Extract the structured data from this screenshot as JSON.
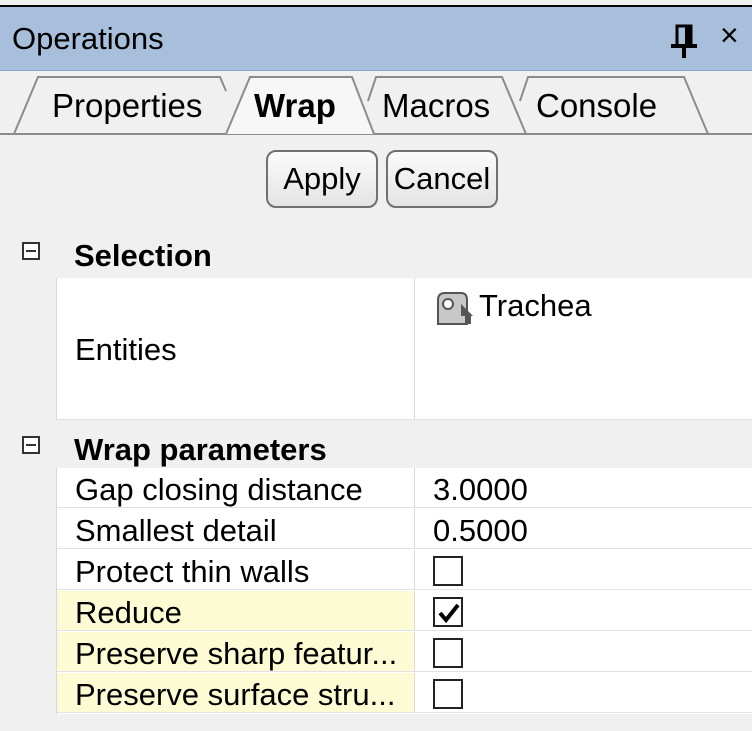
{
  "panel": {
    "title": "Operations",
    "pin_icon": "pin-icon",
    "close_label": "×"
  },
  "tabs": [
    {
      "label": "Properties",
      "active": false
    },
    {
      "label": "Wrap",
      "active": true
    },
    {
      "label": "Macros",
      "active": false
    },
    {
      "label": "Console",
      "active": false
    }
  ],
  "buttons": {
    "apply": "Apply",
    "cancel": "Cancel"
  },
  "sections": {
    "selection": {
      "label": "Selection",
      "entities_label": "Entities",
      "entity_name": "Trachea",
      "entity_icon": "part-icon"
    },
    "wrap_parameters": {
      "label": "Wrap parameters",
      "rows": [
        {
          "name": "Gap closing distance",
          "value": "3.0000"
        },
        {
          "name": "Smallest detail",
          "value": "0.5000"
        },
        {
          "name": "Protect thin walls",
          "checked": false
        },
        {
          "name": "Reduce",
          "checked": true
        },
        {
          "name": "Preserve sharp featur...",
          "checked": false
        },
        {
          "name": "Preserve surface stru...",
          "checked": false
        }
      ]
    }
  },
  "colors": {
    "title_bar": "#a7bfda",
    "highlight_row": "#fdfbd3",
    "grid_background": "#ffffff",
    "panel_background": "#f0f0f0"
  }
}
